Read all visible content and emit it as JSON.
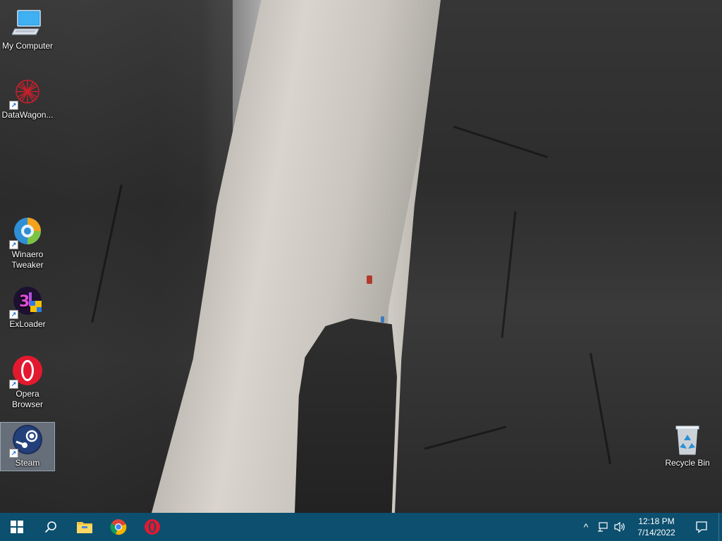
{
  "desktop": {
    "icons": [
      {
        "name": "my-computer",
        "label": "My Computer"
      },
      {
        "name": "datawagon",
        "label": "DataWagon..."
      },
      {
        "name": "winaero-tweaker",
        "label": "Winaero Tweaker"
      },
      {
        "name": "exloader",
        "label": "ExLoader"
      },
      {
        "name": "opera-browser",
        "label": "Opera Browser"
      },
      {
        "name": "steam",
        "label": "Steam"
      },
      {
        "name": "recycle-bin",
        "label": "Recycle Bin"
      }
    ]
  },
  "taskbar": {
    "pinned": [
      "start-icon",
      "search-icon",
      "file-explorer-icon",
      "chrome-icon",
      "opera-icon"
    ],
    "tray": {
      "chevron": "^",
      "time": "12:18 PM",
      "date": "7/14/2022"
    }
  },
  "colors": {
    "taskbar": "#0c4f6e",
    "start_blue": "#ffffff",
    "opera_red": "#e3192f",
    "chrome_red": "#db4437",
    "chrome_yellow": "#f4b400",
    "chrome_green": "#0f9d58",
    "chrome_blue": "#4285f4",
    "folder_yellow": "#f5c542"
  }
}
